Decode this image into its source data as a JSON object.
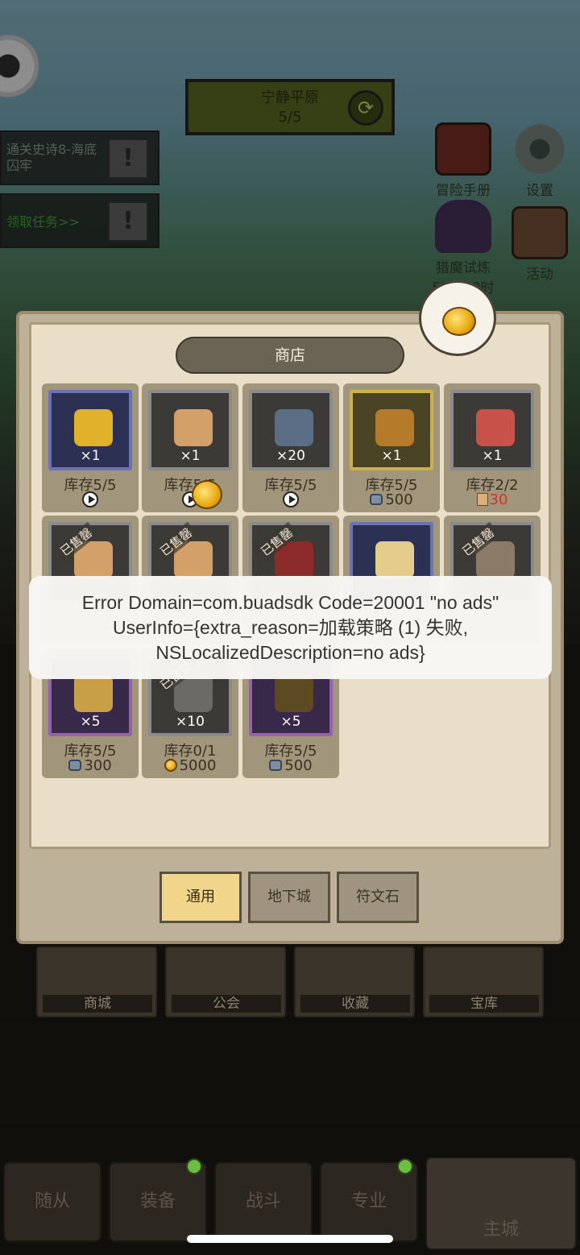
{
  "banner": {
    "title": "宁静平原",
    "progress": "5/5"
  },
  "quests": [
    {
      "text": "通关史诗8-海底囚牢",
      "color": "#8a8f84"
    },
    {
      "text": "领取任务>>",
      "color": "#3f9a34"
    }
  ],
  "side_buttons": [
    {
      "label": "冒险手册",
      "sub": ""
    },
    {
      "label": "设置",
      "sub": ""
    },
    {
      "label": "猎魔试炼",
      "sub": "53天10时"
    },
    {
      "label": "活动",
      "sub": ""
    }
  ],
  "shop": {
    "title": "商店",
    "items": [
      {
        "count": "×1",
        "stock": "库存5/5",
        "price": "",
        "price_type": "ad",
        "frame": "blue",
        "sold": false,
        "art": "gold-coins"
      },
      {
        "count": "×1",
        "stock": "库存5/5",
        "price": "",
        "price_type": "ad",
        "frame": "grey",
        "sold": false,
        "art": "scroll"
      },
      {
        "count": "×20",
        "stock": "库存5/5",
        "price": "",
        "price_type": "ad",
        "frame": "grey",
        "sold": false,
        "art": "gem"
      },
      {
        "count": "×1",
        "stock": "库存5/5",
        "price": "500",
        "price_type": "gem",
        "frame": "gold",
        "sold": false,
        "art": "treasure-chest"
      },
      {
        "count": "×1",
        "stock": "库存2/2",
        "price": "30",
        "price_type": "scroll",
        "frame": "grey",
        "sold": false,
        "art": "red-cloth"
      },
      {
        "count": "",
        "stock": "",
        "price": "",
        "price_type": "",
        "frame": "grey",
        "sold": true,
        "art": "scroll"
      },
      {
        "count": "",
        "stock": "",
        "price": "",
        "price_type": "",
        "frame": "grey",
        "sold": true,
        "art": "scroll"
      },
      {
        "count": "",
        "stock": "",
        "price": "",
        "price_type": "",
        "frame": "grey",
        "sold": true,
        "art": "red-worm"
      },
      {
        "count": "",
        "stock": "",
        "price": "",
        "price_type": "",
        "frame": "blue",
        "sold": false,
        "art": "bone-worm"
      },
      {
        "count": "",
        "stock": "",
        "price": "",
        "price_type": "",
        "frame": "grey",
        "sold": true,
        "art": "pickaxe"
      },
      {
        "count": "×5",
        "stock": "库存5/5",
        "price": "300",
        "price_type": "gem",
        "frame": "purple",
        "sold": false,
        "art": "hammer"
      },
      {
        "count": "×10",
        "stock": "库存0/1",
        "price": "5000",
        "price_type": "coin",
        "frame": "grey",
        "sold": true,
        "art": "tombstone"
      },
      {
        "count": "×5",
        "stock": "库存5/5",
        "price": "500",
        "price_type": "gem",
        "frame": "purple",
        "sold": false,
        "art": "tombstone-gold"
      }
    ],
    "sold_label": "已售罄",
    "tabs": [
      {
        "label": "通用",
        "active": true
      },
      {
        "label": "地下城",
        "active": false
      },
      {
        "label": "符文石",
        "active": false
      }
    ]
  },
  "town_buildings": [
    "商城",
    "公会",
    "收藏",
    "宝库"
  ],
  "error_toast": {
    "line1": "Error Domain=com.buadsdk Code=20001 \"no ads\"",
    "line2": "UserInfo={extra_reason=加载策略 (1) 失败,",
    "line3": "NSLocalizedDescription=no ads}"
  },
  "bottom_nav": [
    {
      "label": "随从",
      "badge": false
    },
    {
      "label": "装备",
      "badge": true
    },
    {
      "label": "战斗",
      "badge": false
    },
    {
      "label": "专业",
      "badge": true
    },
    {
      "label": "主城",
      "badge": false
    }
  ]
}
